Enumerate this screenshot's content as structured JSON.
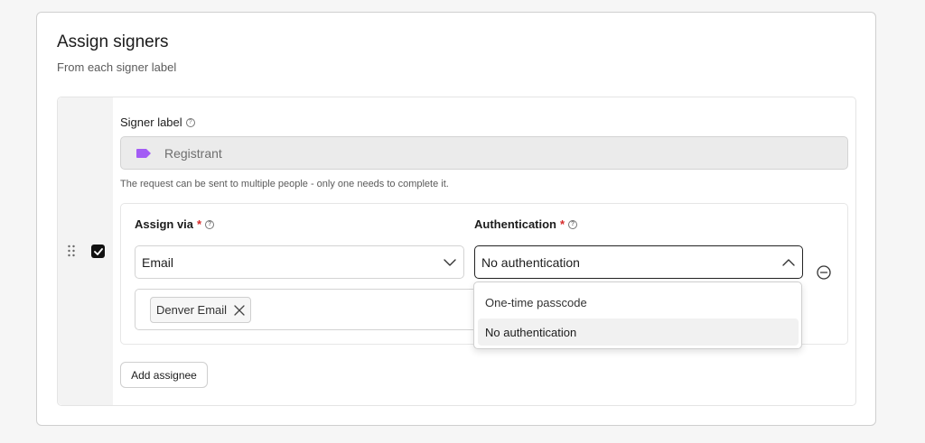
{
  "card": {
    "title": "Assign signers",
    "subtitle": "From each signer label"
  },
  "signer": {
    "label_heading": "Signer label",
    "label_value": "Registrant",
    "note": "The request can be sent to multiple people - only one needs to complete it.",
    "checked": true
  },
  "assign": {
    "via_heading": "Assign via",
    "via_required": "*",
    "via_value": "Email",
    "auth_heading": "Authentication",
    "auth_required": "*",
    "auth_value": "No authentication",
    "recipients": [
      "Denver Email"
    ]
  },
  "auth_dropdown": {
    "options": [
      {
        "label": "One-time passcode",
        "selected": false
      },
      {
        "label": "No authentication",
        "selected": true
      }
    ]
  },
  "actions": {
    "add_assignee": "Add assignee"
  },
  "colors": {
    "tag_accent": "#a35cf5",
    "required": "#d62a2a",
    "checkbox": "#111111"
  },
  "icons": [
    "help-icon",
    "tag-icon",
    "drag-handle-icon",
    "checkbox-checked-icon",
    "chevron-down-icon",
    "chevron-up-icon",
    "close-icon",
    "minus-circle-icon"
  ]
}
